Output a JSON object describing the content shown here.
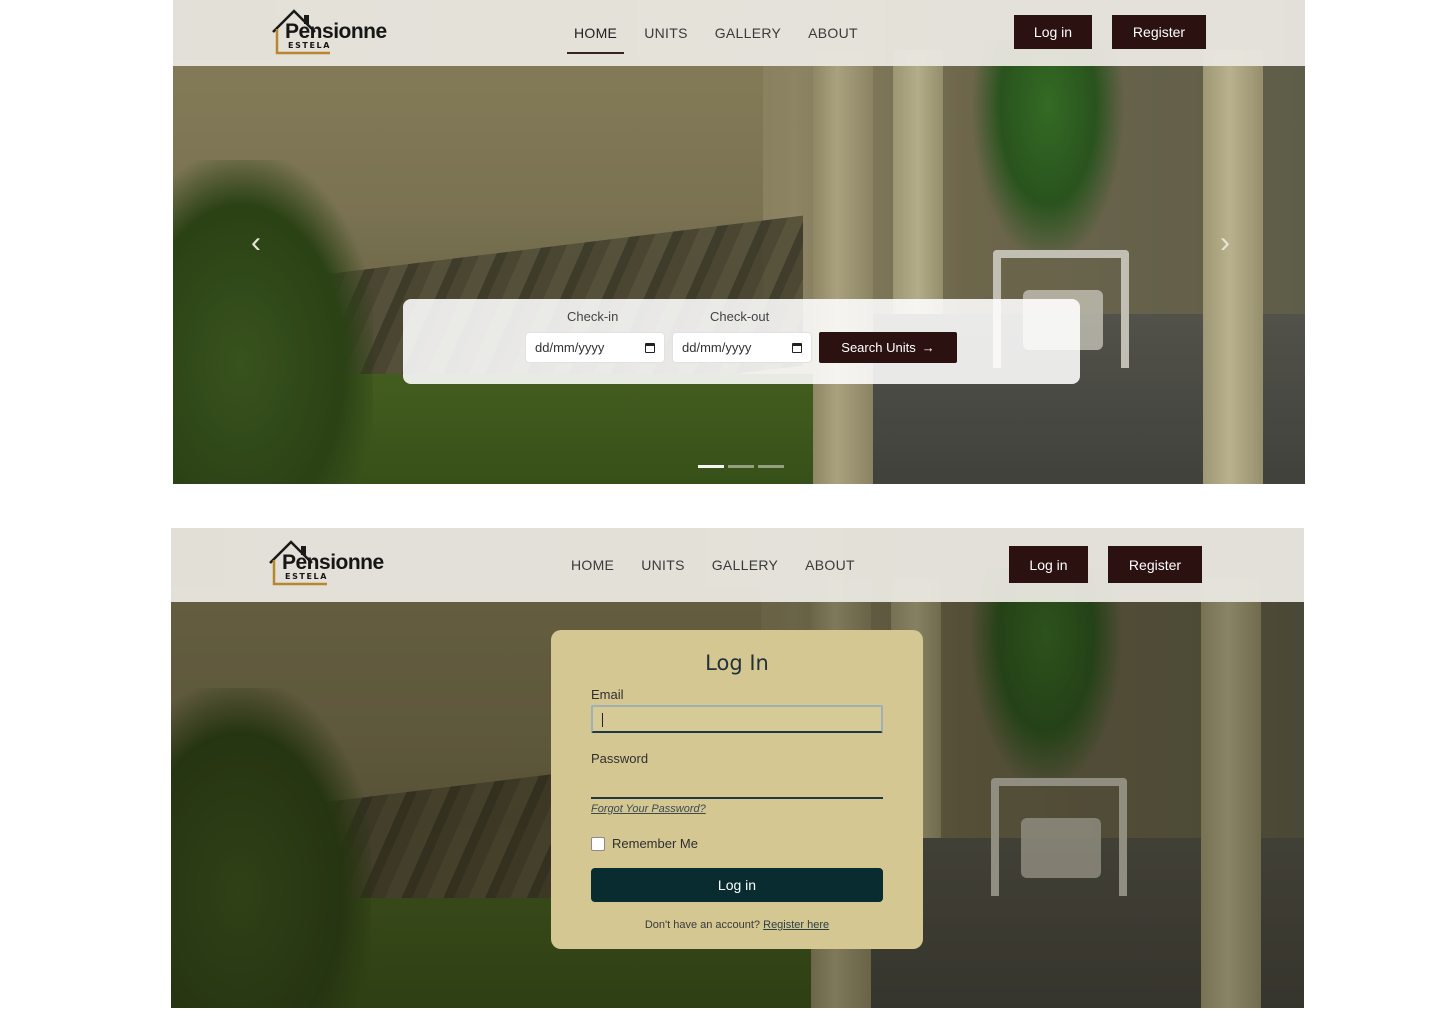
{
  "brand": {
    "name": "Pensionne",
    "sub": "ESTELA",
    "colors": {
      "primary_dark": "#2b1211",
      "card_bg": "#d4c792",
      "login_button": "#082c2f",
      "nav_bg": "#e8e6df"
    }
  },
  "nav": {
    "items": [
      {
        "label": "HOME"
      },
      {
        "label": "UNITS"
      },
      {
        "label": "GALLERY"
      },
      {
        "label": "ABOUT"
      }
    ],
    "active": "HOME",
    "login_label": "Log in",
    "register_label": "Register"
  },
  "hero": {
    "prev_icon": "chevron-left-icon",
    "next_icon": "chevron-right-icon",
    "slides_count": 3,
    "active_slide": 1
  },
  "search": {
    "checkin_label": "Check-in",
    "checkout_label": "Check-out",
    "checkin_value": "dd/mm/yyyy",
    "checkout_value": "dd/mm/yyyy",
    "button_label": "Search Units",
    "button_arrow": "→"
  },
  "login": {
    "title": "Log In",
    "email_label": "Email",
    "email_value": "",
    "password_label": "Password",
    "password_value": "",
    "forgot_label": "Forgot Your Password?",
    "remember_label": "Remember Me",
    "remember_checked": false,
    "submit_label": "Log in",
    "no_account_text": "Don't have an account?",
    "register_link": "Register here"
  }
}
